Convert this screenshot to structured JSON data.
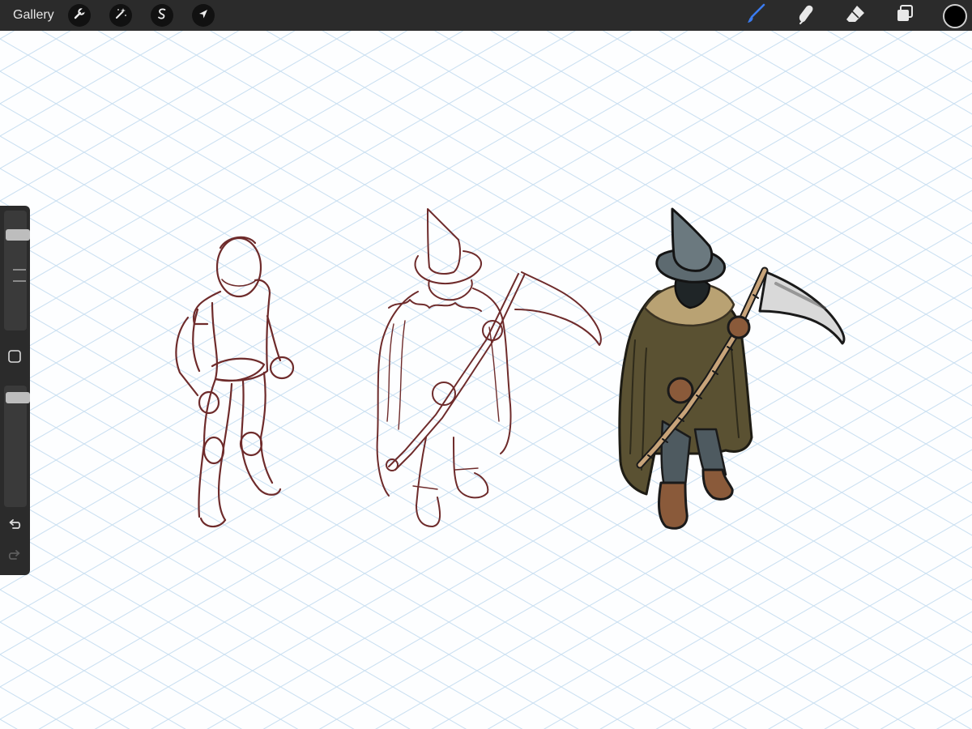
{
  "topbar": {
    "gallery_label": "Gallery",
    "left_tools": [
      {
        "name": "actions",
        "icon": "wrench-icon"
      },
      {
        "name": "adjustments",
        "icon": "magic-wand-icon"
      },
      {
        "name": "selection",
        "icon": "selection-s-icon"
      },
      {
        "name": "transform",
        "icon": "arrow-cursor-icon"
      }
    ],
    "right_tools": [
      {
        "name": "brush",
        "icon": "brush-icon",
        "active": true
      },
      {
        "name": "smudge",
        "icon": "smudge-icon",
        "active": false
      },
      {
        "name": "eraser",
        "icon": "eraser-icon",
        "active": false
      },
      {
        "name": "layers",
        "icon": "layers-icon",
        "active": false
      }
    ],
    "current_color": "#000000"
  },
  "colors": {
    "toolbar_bg": "#2b2b2b",
    "active_tool": "#3a7bf0",
    "grid_line": "#c9dff1",
    "sketch_line": "#6e2b2b"
  },
  "sidebar": {
    "brush_size_level": 0.17,
    "opacity_level": 0.06,
    "modify_button_icon": "square-icon",
    "undo_icon": "undo-icon",
    "redo_icon": "redo-icon"
  },
  "canvas": {
    "grid": "isometric",
    "figures": [
      {
        "name": "mannequin-sketch",
        "style": "line"
      },
      {
        "name": "reaper-line-sketch",
        "style": "line"
      },
      {
        "name": "reaper-colored",
        "style": "color"
      }
    ]
  }
}
